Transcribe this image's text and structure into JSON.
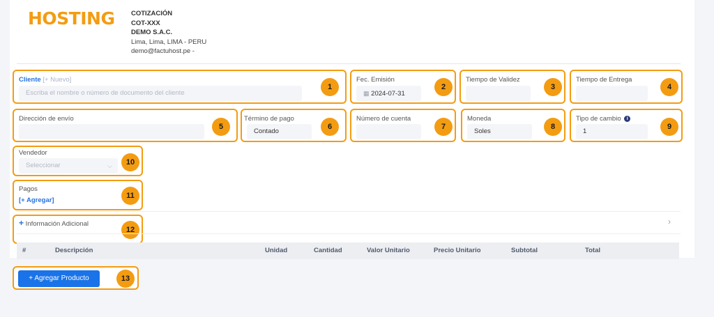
{
  "header": {
    "logo_text": "HOSTING",
    "doc_type": "COTIZACIÓN",
    "doc_number": "COT-XXX",
    "company": "DEMO S.A.C.",
    "address": "Lima, Lima, LIMA - PERU",
    "email": "demo@factuhost.pe -"
  },
  "fields": {
    "cliente": {
      "label": "Cliente",
      "new_link": "[+ Nuevo]",
      "placeholder": "Escriba el nombre o número de documento del cliente",
      "badge": "1"
    },
    "fec_emision": {
      "label": "Fec. Emisión",
      "value": "2024-07-31",
      "badge": "2"
    },
    "tiempo_validez": {
      "label": "Tiempo de Validez",
      "value": "",
      "badge": "3"
    },
    "tiempo_entrega": {
      "label": "Tiempo de Entrega",
      "value": "",
      "badge": "4"
    },
    "direccion_envio": {
      "label": "Dirección de envío",
      "value": "",
      "badge": "5"
    },
    "termino_pago": {
      "label": "Término de pago",
      "value": "Contado",
      "badge": "6"
    },
    "numero_cuenta": {
      "label": "Número de cuenta",
      "value": "",
      "badge": "7"
    },
    "moneda": {
      "label": "Moneda",
      "value": "Soles",
      "badge": "8"
    },
    "tipo_cambio": {
      "label": "Tipo de cambio",
      "value": "1",
      "badge": "9"
    },
    "vendedor": {
      "label": "Vendedor",
      "placeholder": "Seleccionar",
      "badge": "10"
    },
    "pagos": {
      "label": "Pagos",
      "add_link": "[+ Agregar]",
      "badge": "11"
    },
    "info_adicional": {
      "label": "Información Adicional",
      "badge": "12"
    }
  },
  "table": {
    "columns": [
      "#",
      "Descripción",
      "Unidad",
      "Cantidad",
      "Valor Unitario",
      "Precio Unitario",
      "Subtotal",
      "Total"
    ]
  },
  "actions": {
    "add_product_label": "+ Agregar Producto",
    "badge": "13"
  },
  "colors": {
    "accent": "#f39c12",
    "primary": "#1a73e8",
    "link": "#2473e0"
  }
}
